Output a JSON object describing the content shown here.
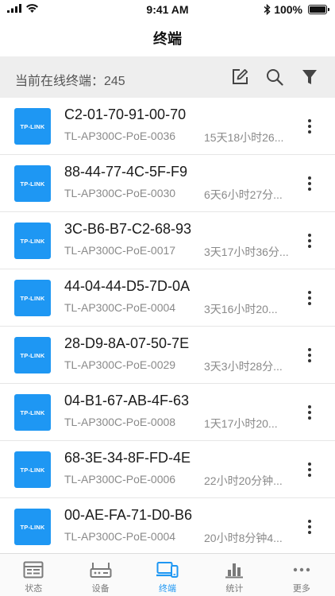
{
  "status_bar": {
    "time": "9:41 AM",
    "battery": "100%"
  },
  "header": {
    "title": "终端"
  },
  "summary": {
    "text": "当前在线终端：245",
    "icons": [
      "edit-icon",
      "search-icon",
      "filter-icon"
    ]
  },
  "devices": [
    {
      "logo": "TP-LINK",
      "mac": "C2-01-70-91-00-70",
      "model": "TL-AP300C-PoE-0036",
      "duration": "15天18小时26..."
    },
    {
      "logo": "TP-LINK",
      "mac": "88-44-77-4C-5F-F9",
      "model": "TL-AP300C-PoE-0030",
      "duration": "6天6小时27分..."
    },
    {
      "logo": "TP-LINK",
      "mac": "3C-B6-B7-C2-68-93",
      "model": "TL-AP300C-PoE-0017",
      "duration": "3天17小时36分..."
    },
    {
      "logo": "TP-LINK",
      "mac": "44-04-44-D5-7D-0A",
      "model": "TL-AP300C-PoE-0004",
      "duration": "3天16小时20..."
    },
    {
      "logo": "TP-LINK",
      "mac": "28-D9-8A-07-50-7E",
      "model": "TL-AP300C-PoE-0029",
      "duration": "3天3小时28分..."
    },
    {
      "logo": "TP-LINK",
      "mac": "04-B1-67-AB-4F-63",
      "model": "TL-AP300C-PoE-0008",
      "duration": "1天17小时20..."
    },
    {
      "logo": "TP-LINK",
      "mac": "68-3E-34-8F-FD-4E",
      "model": "TL-AP300C-PoE-0006",
      "duration": "22小时20分钟..."
    },
    {
      "logo": "TP-LINK",
      "mac": "00-AE-FA-71-D0-B6",
      "model": "TL-AP300C-PoE-0004",
      "duration": "20小时8分钟4..."
    }
  ],
  "tabs": [
    {
      "label": "状态",
      "icon": "status-icon",
      "active": false
    },
    {
      "label": "设备",
      "icon": "router-icon",
      "active": false
    },
    {
      "label": "终端",
      "icon": "terminal-devices-icon",
      "active": true
    },
    {
      "label": "统计",
      "icon": "bar-chart-icon",
      "active": false
    },
    {
      "label": "更多",
      "icon": "more-horizontal-icon",
      "active": false
    }
  ],
  "colors": {
    "accent": "#1e97f3",
    "summary_bg": "#eeeeee",
    "secondary_text": "#8a8a8a"
  }
}
